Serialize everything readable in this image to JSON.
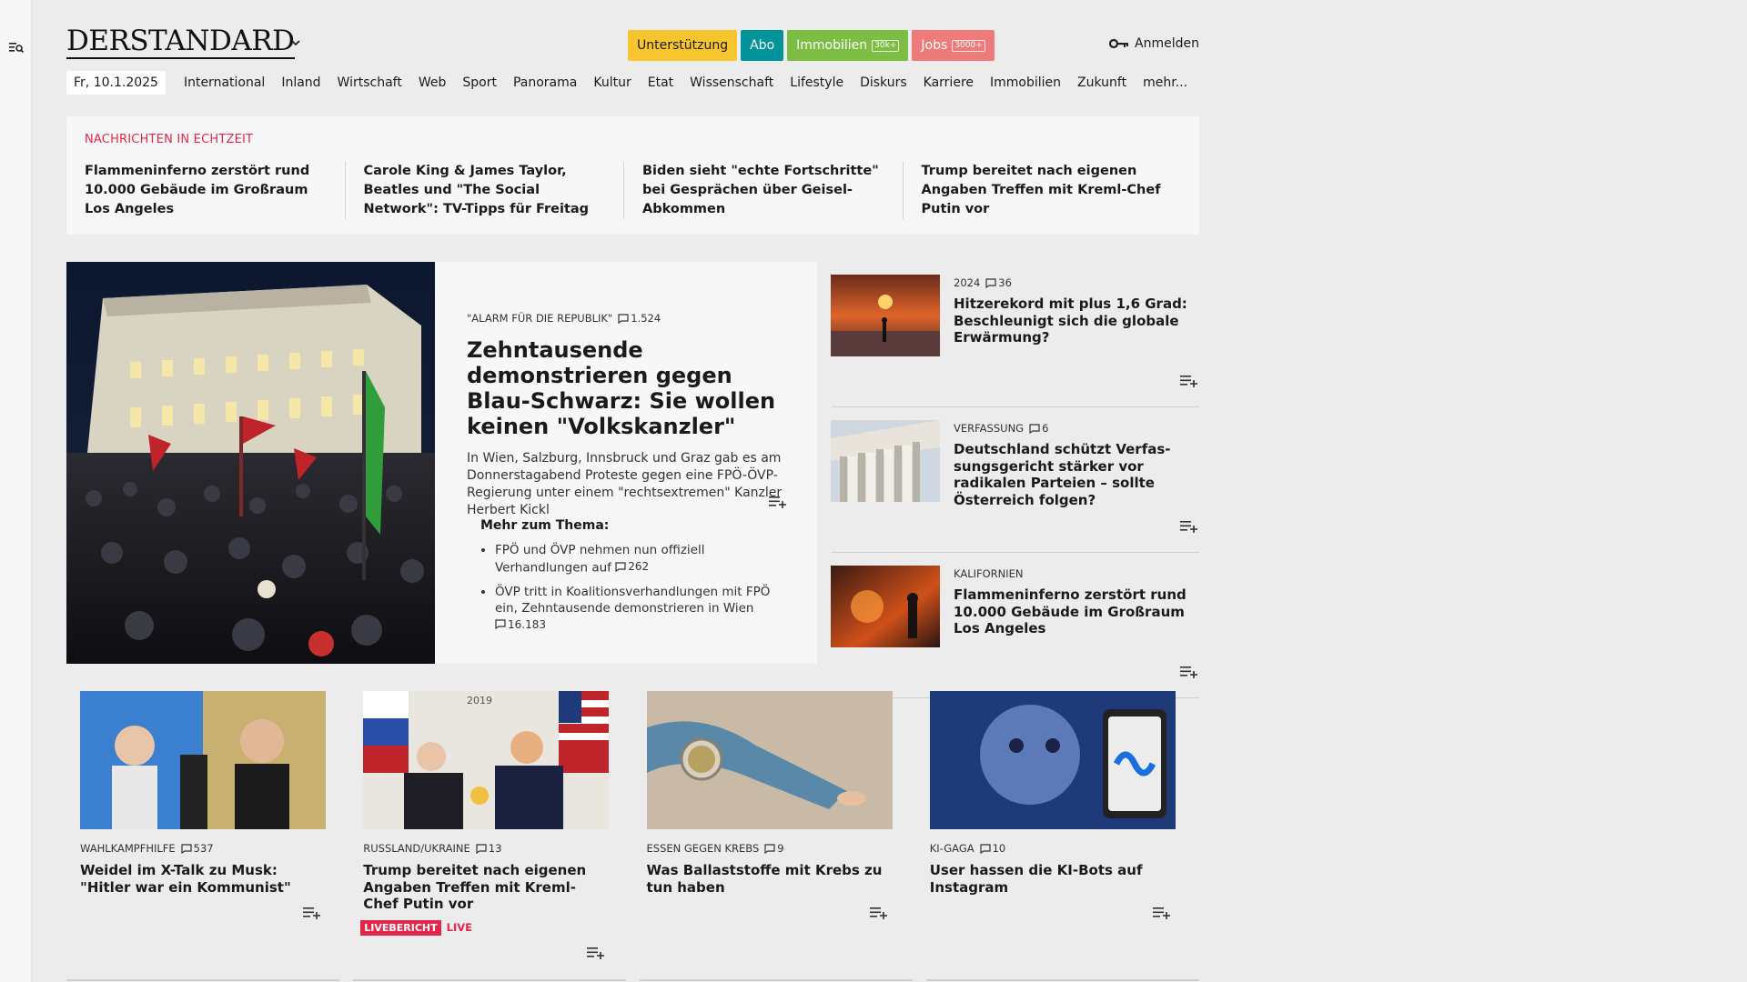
{
  "brand": {
    "logo_text": "DERSTANDARD"
  },
  "promo": {
    "support": "Unterstützung",
    "abo": "Abo",
    "immobilien": "Immobilien",
    "immobilien_badge": "30k+",
    "jobs": "Jobs",
    "jobs_badge": "3000+"
  },
  "login_label": "Anmelden",
  "nav": {
    "date": "Fr, 10.1.2025",
    "items": [
      "International",
      "Inland",
      "Wirtschaft",
      "Web",
      "Sport",
      "Panorama",
      "Kultur",
      "Etat",
      "Wissenschaft",
      "Lifestyle",
      "Diskurs",
      "Karriere",
      "Immobilien",
      "Zukunft",
      "mehr..."
    ]
  },
  "ticker": {
    "label": "NACHRICHTEN IN ECHTZEIT",
    "items": [
      "Flammeninferno zerstört rund 10.000 Gebäude im Großraum Los Angeles",
      "Carole King & James Taylor, Beatles und \"The Social Network\": TV-Tipps für Freitag",
      "Biden sieht \"echte Fortschritte\" bei Gesprächen über Geisel-Abkommen",
      "Trump bereitet nach eigenen Angaben Treffen mit Kreml-Chef Putin vor"
    ]
  },
  "lead": {
    "kicker": "\"ALARM FÜR DIE REPUBLIK\"",
    "comments": "1.524",
    "title": "Zehntausende demonstrieren gegen Blau-Schwarz: Sie wollen keinen \"Volkskanzler\"",
    "teaser": "In Wien, Salzburg, Innsbruck und Graz gab es am Donnerstagabend Proteste gegen eine FPÖ-ÖVP-Re­gierung unter einem \"rechtsextremen\" Kanzler Herbert Kickl",
    "more_title": "Mehr zum Thema:",
    "more": [
      {
        "text": "FPÖ und ÖVP nehmen nun offiziell Verhandlungen auf",
        "comments": "262"
      },
      {
        "text": "ÖVP tritt in Koalitionsverhandlungen mit FPÖ ein, Zehntausende demonstrieren in Wien",
        "comments": "16.183"
      }
    ]
  },
  "side": [
    {
      "kicker": "2024",
      "comments": "36",
      "title": "Hitzerekord mit plus 1,6 Grad: Beschleunigt sich die globale Erwärmung?"
    },
    {
      "kicker": "VERFASSUNG",
      "comments": "6",
      "title": "Deutschland schützt Verfas­sungsgericht stärker vor radikalen Parteien – sollte Österreich folgen?"
    },
    {
      "kicker": "KALIFORNIEN",
      "comments": "",
      "title": "Flammeninferno zerstört rund 10.000 Gebäude im Großraum Los Angeles"
    }
  ],
  "cards": [
    {
      "kicker": "WAHLKAMPFHILFE",
      "comments": "537",
      "title": "Weidel im X-Talk zu Musk: \"Hitler war ein Kommunist\""
    },
    {
      "kicker": "RUSSLAND/UKRAINE",
      "comments": "13",
      "title": "Trump bereitet nach eigenen Angaben Treffen mit Kreml-Chef Putin vor",
      "live_tag": "LIVEBERICHT",
      "live_word": "LIVE",
      "img_year": "2019"
    },
    {
      "kicker": "ESSEN GEGEN KREBS",
      "comments": "9",
      "title": "Was Ballaststoffe mit Krebs zu tun haben"
    },
    {
      "kicker": "KI-GAGA",
      "comments": "10",
      "title": "User hassen die KI-Bots auf Instagram"
    }
  ]
}
